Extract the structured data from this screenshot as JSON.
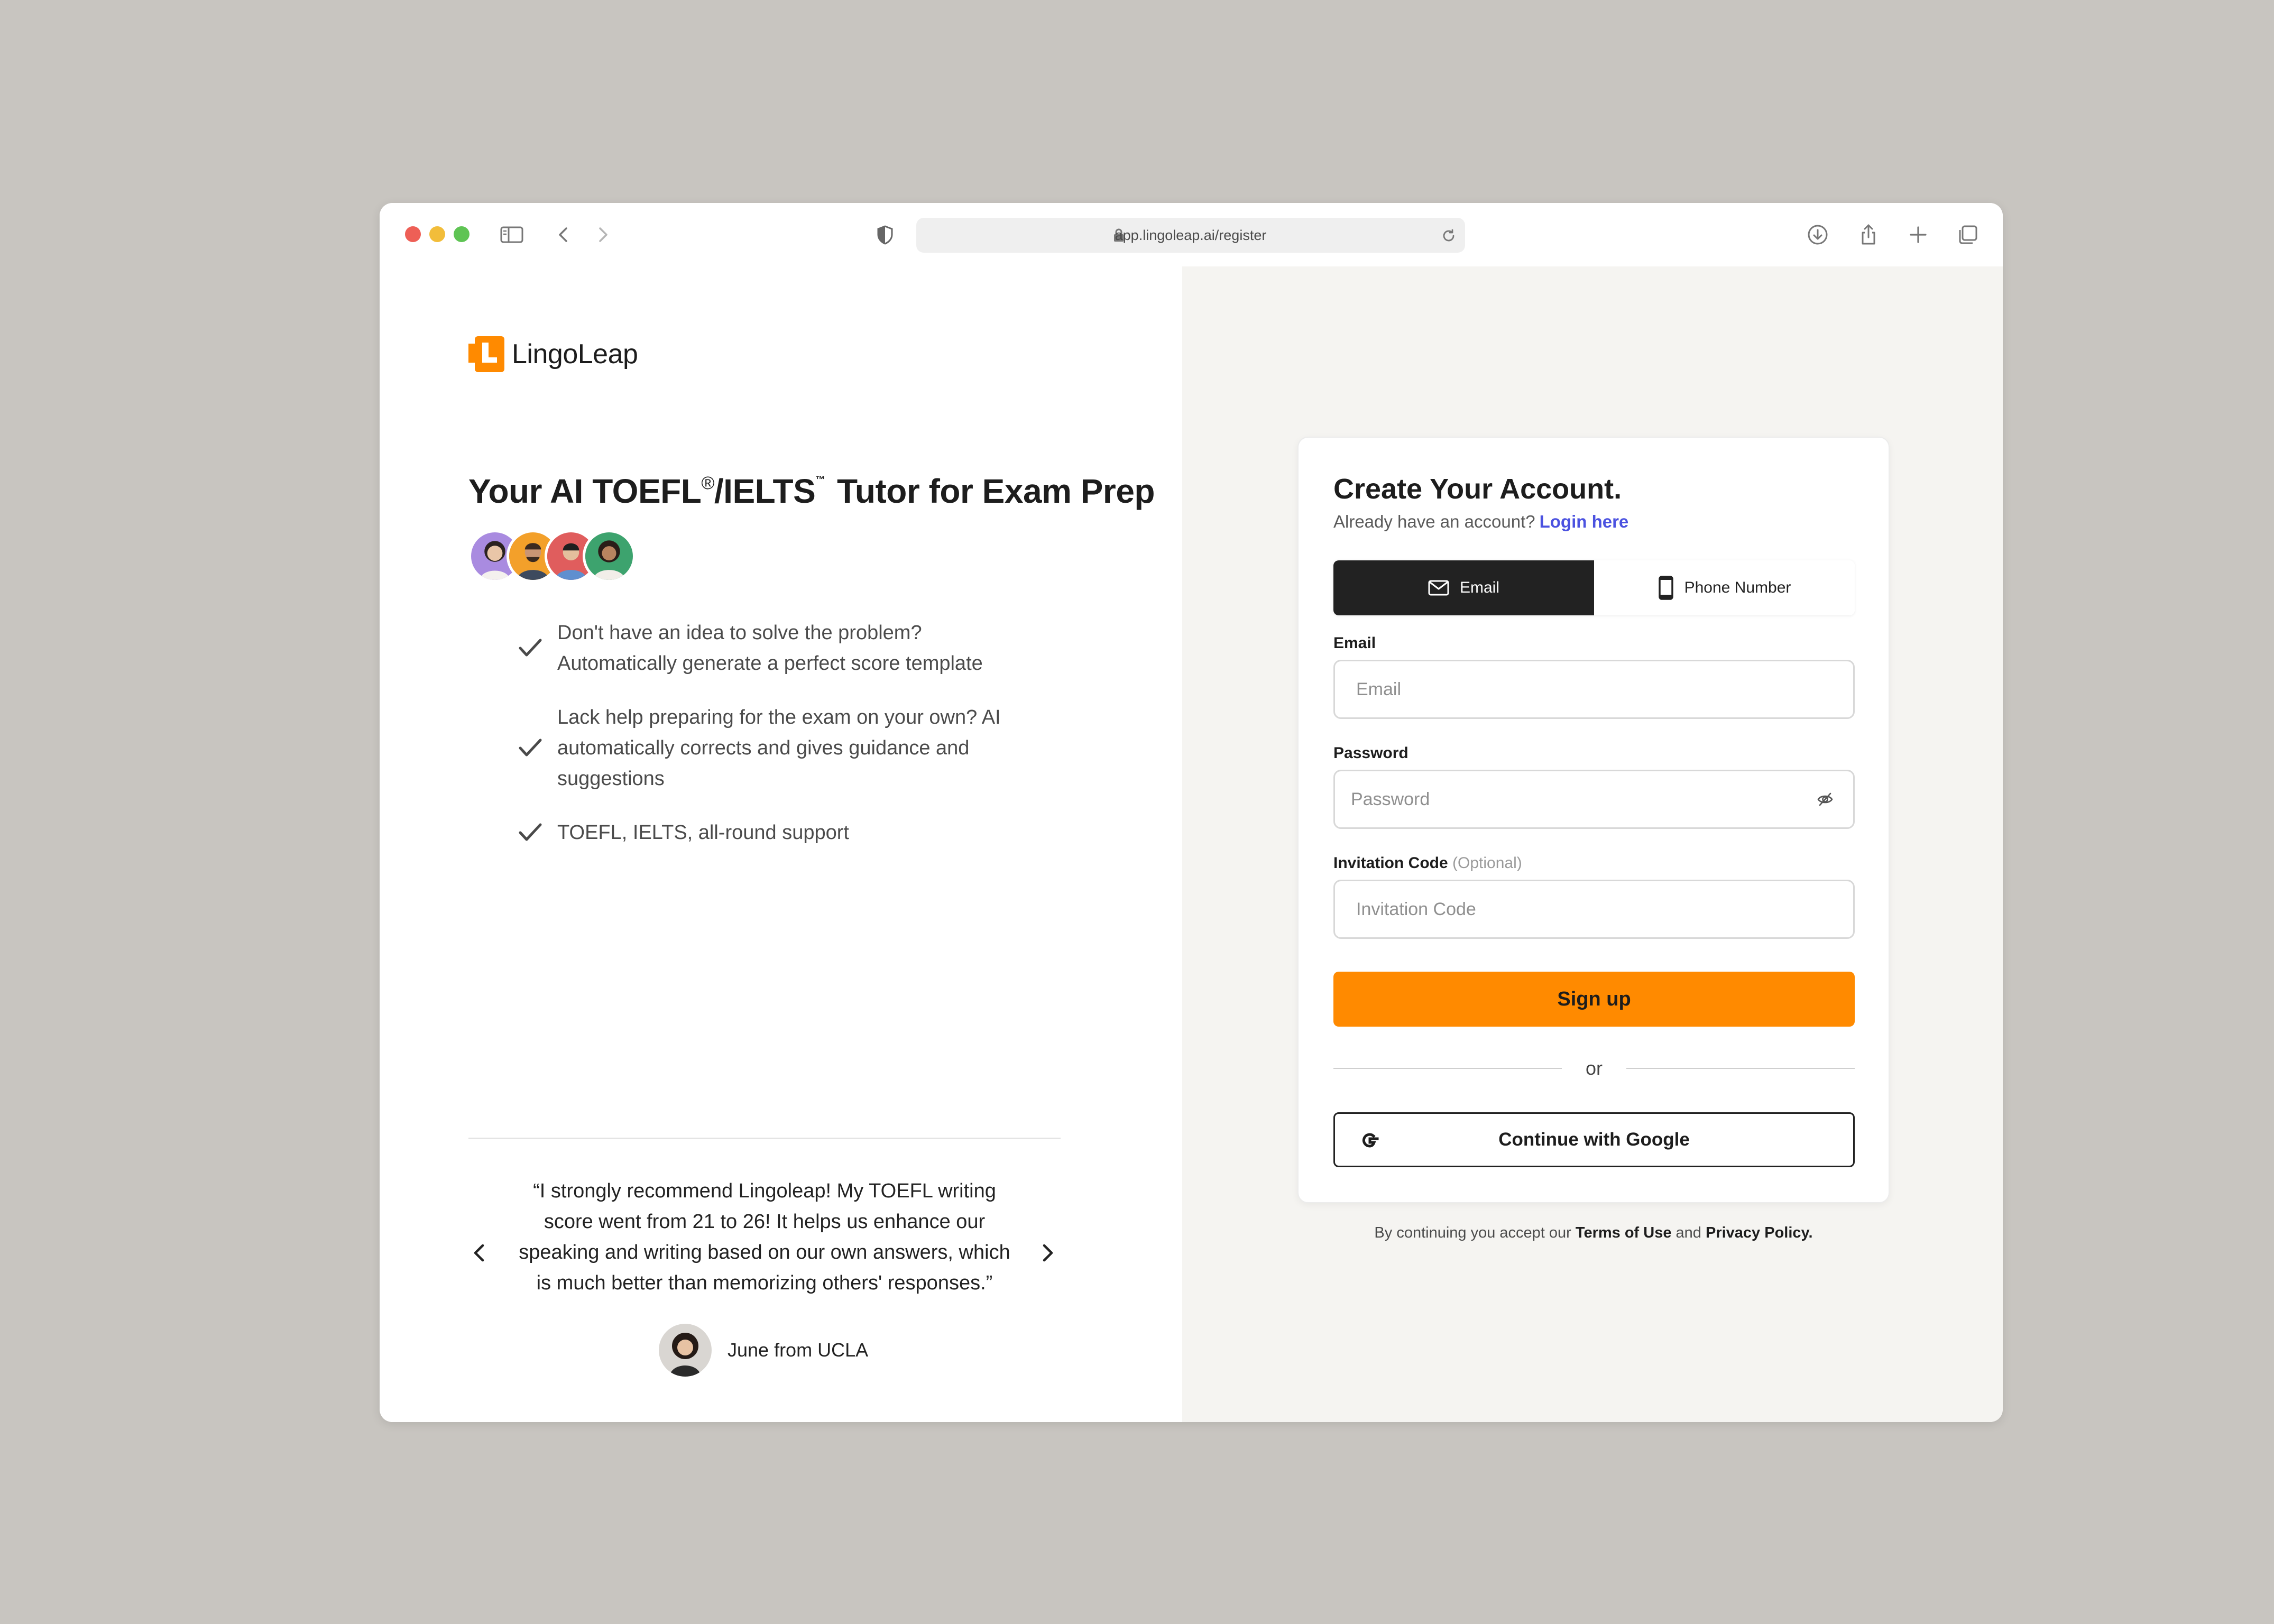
{
  "browser": {
    "url": "app.lingoleap.ai/register"
  },
  "brand": {
    "name": "LingoLeap",
    "accent": "#ff8a00"
  },
  "hero": {
    "title_part1": "Your AI TOEFL",
    "registered_mark": "®",
    "title_part2": "/IELTS",
    "trademark_mark": "™",
    "title_part3": "Tutor for Exam Prep"
  },
  "features": [
    "Don't have an idea to solve the problem? Automatically generate a perfect score template",
    "Lack help preparing for the exam on your own? AI automatically corrects and gives guidance and suggestions",
    "TOEFL, IELTS, all-round support"
  ],
  "testimonial": {
    "quote": "“I strongly recommend Lingoleap! My TOEFL writing score went from 21 to 26! It helps us enhance our speaking and writing based on our own answers, which is much better than memorizing others' responses.”",
    "author": "June from UCLA"
  },
  "signup": {
    "title": "Create Your Account.",
    "have_account": "Already have an account?",
    "login_link": "Login here",
    "tabs": {
      "email": "Email",
      "phone": "Phone Number"
    },
    "email_label": "Email",
    "email_placeholder": "Email",
    "password_label": "Password",
    "password_placeholder": "Password",
    "invite_label": "Invitation Code",
    "invite_optional": "(Optional)",
    "invite_placeholder": "Invitation Code",
    "submit": "Sign up",
    "or": "or",
    "google": "Continue with Google",
    "terms_prefix": "By continuing you accept our",
    "terms_link": "Terms of Use",
    "terms_and": "and",
    "privacy_link": "Privacy Policy."
  }
}
